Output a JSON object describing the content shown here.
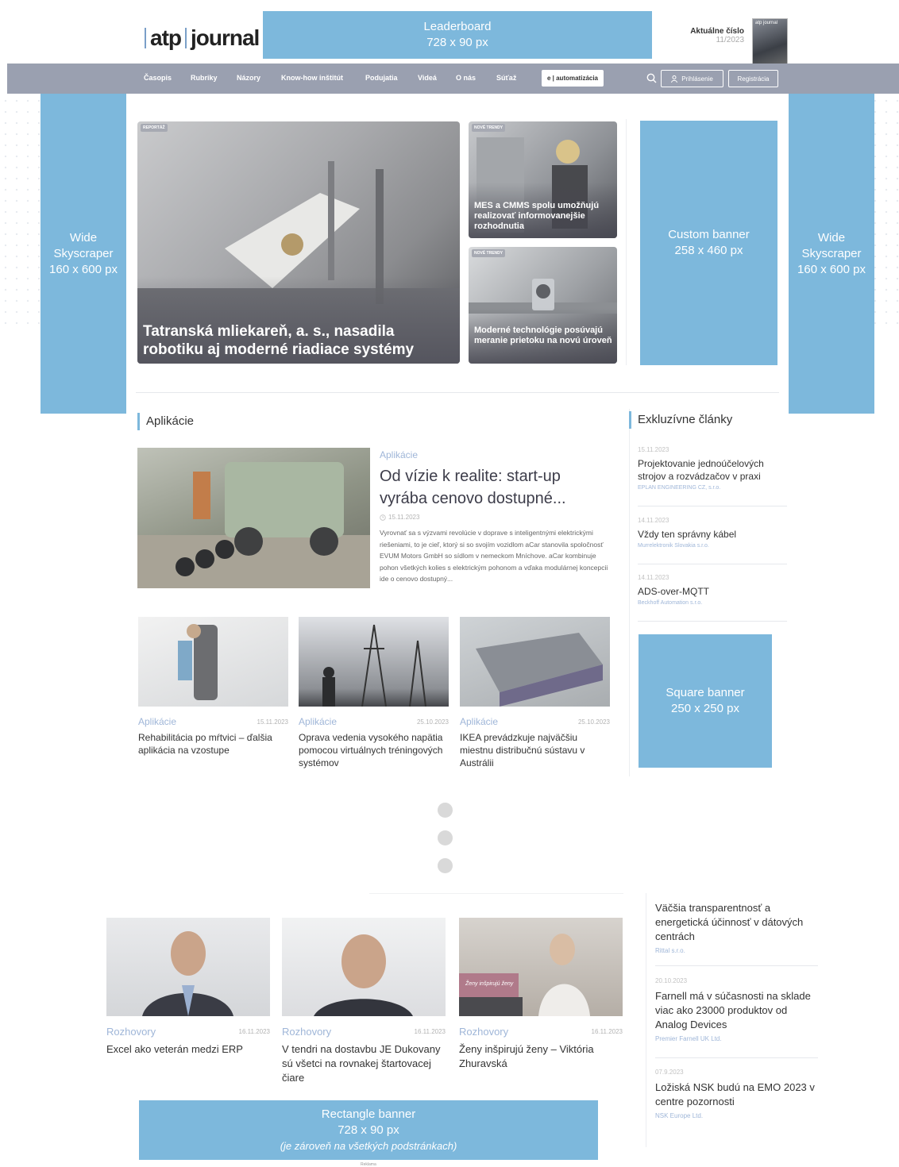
{
  "header": {
    "logo_a": "atp",
    "logo_b": "journal",
    "issue_label": "Aktuálne číslo",
    "issue_number": "11/2023",
    "cover_text": "atp journal"
  },
  "ads": {
    "leaderboard": {
      "name": "Leaderboard",
      "size": "728 x 90 px"
    },
    "wide_left": {
      "l1": "Wide",
      "l2": "Skyscraper",
      "size": "160 x 600 px"
    },
    "wide_right": {
      "l1": "Wide",
      "l2": "Skyscraper",
      "size": "160 x 600 px"
    },
    "custom": {
      "name": "Custom banner",
      "size": "258 x 460 px"
    },
    "square": {
      "name": "Square banner",
      "size": "250 x 250 px"
    },
    "rectangle": {
      "name": "Rectangle banner",
      "size": "728 x 90 px",
      "note": "(je zároveň na všetkých podstránkach)"
    },
    "reklama": "Reklama",
    "color": "#7db8dc"
  },
  "nav": {
    "items": [
      "Časopis",
      "Rubriky",
      "Názory",
      "Know-how inštitút",
      "Podujatia",
      "Videá",
      "O nás",
      "Súťaž"
    ],
    "automatizacia": "e | automatizácia",
    "login": "Prihlásenie",
    "register": "Registrácia",
    "color": "#9aa0b0"
  },
  "hero": {
    "main": {
      "tag": "REPORTÁŽ",
      "title": "Tatranská mliekareň, a. s., nasadila robotiku aj moderné riadiace systémy"
    },
    "side1": {
      "tag": "NOVÉ TRENDY",
      "title": "MES a CMMS spolu umožňujú realizovať informovanejšie rozhodnutia"
    },
    "side2": {
      "tag": "NOVÉ TRENDY",
      "title": "Moderné technológie posúvajú meranie prietoku na novú úroveň"
    }
  },
  "aplikacie": {
    "heading": "Aplikácie",
    "featured": {
      "category": "Aplikácie",
      "title": "Od vízie k realite: start-up vyrába cenovo dostupné...",
      "date": "15.11.2023",
      "text": "Vyrovnať sa s výzvami revolúcie v doprave s inteligentnými elektrickými riešeniami, to je cieľ, ktorý si so svojím vozidlom aCar stanovila spoločnosť EVUM Motors GmbH so sídlom v nemeckom Mníchove. aCar kombinuje pohon všetkých kolies s elektrickým pohonom a vďaka modulárnej koncepcii ide o cenovo dostupný..."
    },
    "cards": [
      {
        "category": "Aplikácie",
        "date": "15.11.2023",
        "title": "Rehabilitácia po mŕtvici – ďalšia aplikácia na vzostupe"
      },
      {
        "category": "Aplikácie",
        "date": "25.10.2023",
        "title": "Oprava vedenia vysokého napätia pomocou virtuálnych tréningových systémov"
      },
      {
        "category": "Aplikácie",
        "date": "25.10.2023",
        "title": "IKEA prevádzkuje najväčšiu miestnu distribučnú sústavu v Austrálii"
      }
    ]
  },
  "exkluzivne": {
    "heading": "Exkluzívne články",
    "items": [
      {
        "date": "15.11.2023",
        "title": "Projektovanie jednoúčelových strojov a rozvádzačov v praxi",
        "company": "EPLAN ENGINEERING CZ, s.r.o."
      },
      {
        "date": "14.11.2023",
        "title": "Vždy ten správny kábel",
        "company": "Murrelektronik Slovakia s.r.o."
      },
      {
        "date": "14.11.2023",
        "title": "ADS-over-MQTT",
        "company": "Beckhoff Automation s.r.o."
      }
    ]
  },
  "rozhovory": {
    "cards": [
      {
        "category": "Rozhovory",
        "date": "16.11.2023",
        "title": "Excel ako veterán medzi ERP"
      },
      {
        "category": "Rozhovory",
        "date": "16.11.2023",
        "title": "V tendri na dostavbu JE Dukovany sú všetci na rovnakej štartovacej čiare"
      },
      {
        "category": "Rozhovory",
        "date": "16.11.2023",
        "title": "Ženy inšpirujú ženy – Viktória Zhuravská",
        "image_text": "Ženy inšpirujú ženy"
      }
    ]
  },
  "side_list": [
    {
      "date": "",
      "title": "Väčšia transparentnosť a energetická účinnosť v dátových centrách",
      "company": "Rittal s.r.o."
    },
    {
      "date": "20.10.2023",
      "title": "Farnell má v súčasnosti na sklade viac ako 23000 produktov od Analog Devices",
      "company": "Premier Farnell UK Ltd."
    },
    {
      "date": "07.9.2023",
      "title": "Ložiská NSK budú na EMO 2023 v centre pozornosti",
      "company": "NSK Europe Ltd."
    }
  ]
}
